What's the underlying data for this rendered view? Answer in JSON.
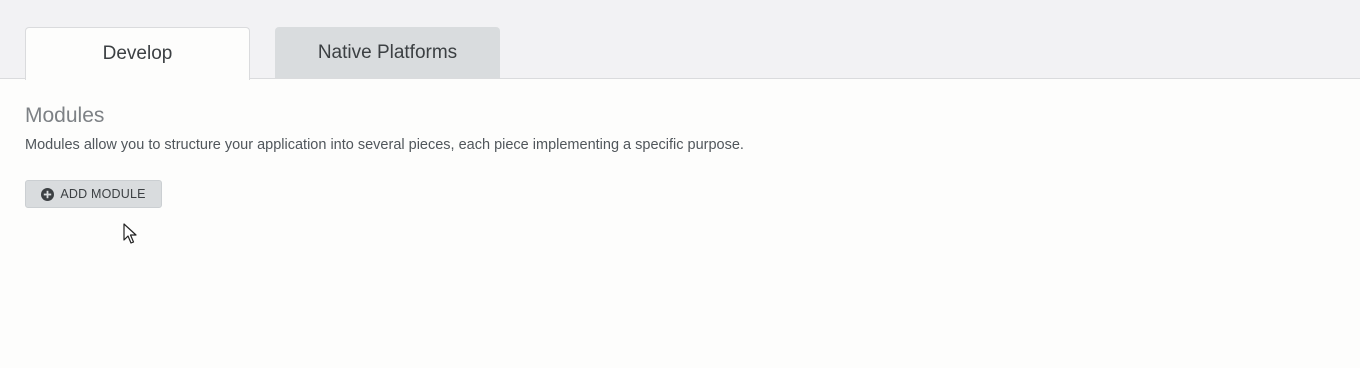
{
  "tabs": [
    {
      "label": "Develop",
      "active": true
    },
    {
      "label": "Native Platforms",
      "active": false
    }
  ],
  "section": {
    "title": "Modules",
    "description": "Modules allow you to structure your application into several pieces, each piece implementing a specific purpose."
  },
  "actions": {
    "add_module_label": "ADD MODULE",
    "add_module_icon": "plus-circle-icon"
  },
  "colors": {
    "tab_active_bg": "#fdfdfc",
    "tab_inactive_bg": "#d9dcde",
    "button_bg": "#d9dcde",
    "title_text": "#7d8185"
  }
}
